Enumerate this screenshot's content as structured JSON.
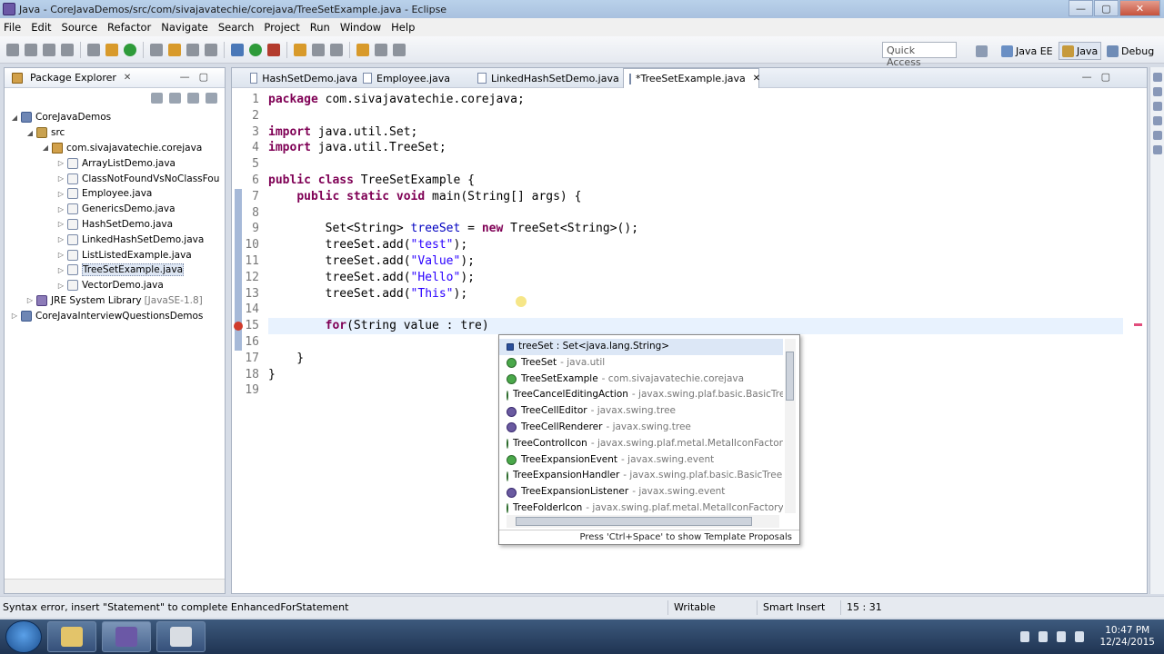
{
  "window": {
    "title": "Java - CoreJavaDemos/src/com/sivajavatechie/corejava/TreeSetExample.java - Eclipse",
    "min": "—",
    "max": "▢",
    "close": "✕"
  },
  "menu": [
    "File",
    "Edit",
    "Source",
    "Refactor",
    "Navigate",
    "Search",
    "Project",
    "Run",
    "Window",
    "Help"
  ],
  "toolbar": {
    "quick_access_placeholder": "Quick Access",
    "perspectives": [
      "Java EE",
      "Java",
      "Debug"
    ]
  },
  "package_explorer": {
    "title": "Package Explorer",
    "tree": [
      {
        "label": "CoreJavaDemos",
        "level": 0,
        "icon": "project-icon",
        "expanded": true
      },
      {
        "label": "src",
        "level": 1,
        "icon": "source-folder-icon",
        "expanded": true
      },
      {
        "label": "com.sivajavatechie.corejava",
        "level": 2,
        "icon": "package-icon",
        "expanded": true
      },
      {
        "label": "ArrayListDemo.java",
        "level": 3,
        "icon": "java-file-icon"
      },
      {
        "label": "ClassNotFoundVsNoClassFou",
        "level": 3,
        "icon": "java-file-icon"
      },
      {
        "label": "Employee.java",
        "level": 3,
        "icon": "java-file-icon"
      },
      {
        "label": "GenericsDemo.java",
        "level": 3,
        "icon": "java-file-icon"
      },
      {
        "label": "HashSetDemo.java",
        "level": 3,
        "icon": "java-file-icon"
      },
      {
        "label": "LinkedHashSetDemo.java",
        "level": 3,
        "icon": "java-file-icon"
      },
      {
        "label": "ListListedExample.java",
        "level": 3,
        "icon": "java-file-icon"
      },
      {
        "label": "TreeSetExample.java",
        "level": 3,
        "icon": "java-file-icon",
        "selected": true
      },
      {
        "label": "VectorDemo.java",
        "level": 3,
        "icon": "java-file-icon"
      },
      {
        "label": "JRE System Library",
        "suffix": "[JavaSE-1.8]",
        "level": 1,
        "icon": "library-icon"
      },
      {
        "label": "CoreJavaInterviewQuestionsDemos",
        "level": 0,
        "icon": "project-icon"
      }
    ]
  },
  "editor": {
    "tabs": [
      {
        "label": "HashSetDemo.java"
      },
      {
        "label": "Employee.java"
      },
      {
        "label": "LinkedHashSetDemo.java"
      },
      {
        "label": "*TreeSetExample.java",
        "active": true
      }
    ],
    "lines": [
      [
        {
          "t": "package",
          "c": "kw"
        },
        {
          "t": " com.sivajavatechie.corejava;"
        }
      ],
      [],
      [
        {
          "t": "import",
          "c": "kw"
        },
        {
          "t": " java.util.Set;"
        }
      ],
      [
        {
          "t": "import",
          "c": "kw"
        },
        {
          "t": " java.util.TreeSet;"
        }
      ],
      [],
      [
        {
          "t": "public",
          "c": "kw"
        },
        {
          "t": " "
        },
        {
          "t": "class",
          "c": "kw"
        },
        {
          "t": " TreeSetExample {"
        }
      ],
      [
        {
          "t": "    "
        },
        {
          "t": "public",
          "c": "kw"
        },
        {
          "t": " "
        },
        {
          "t": "static",
          "c": "kw"
        },
        {
          "t": " "
        },
        {
          "t": "void",
          "c": "kw"
        },
        {
          "t": " main(String[] args) {"
        }
      ],
      [],
      [
        {
          "t": "        Set<String> "
        },
        {
          "t": "treeSet",
          "c": "fld"
        },
        {
          "t": " = "
        },
        {
          "t": "new",
          "c": "kw"
        },
        {
          "t": " TreeSet<String>();"
        }
      ],
      [
        {
          "t": "        treeSet.add("
        },
        {
          "t": "\"test\"",
          "c": "str"
        },
        {
          "t": ");"
        }
      ],
      [
        {
          "t": "        treeSet.add("
        },
        {
          "t": "\"Value\"",
          "c": "str"
        },
        {
          "t": ");"
        }
      ],
      [
        {
          "t": "        treeSet.add("
        },
        {
          "t": "\"Hello\"",
          "c": "str"
        },
        {
          "t": ");"
        }
      ],
      [
        {
          "t": "        treeSet.add("
        },
        {
          "t": "\"This\"",
          "c": "str"
        },
        {
          "t": ");"
        }
      ],
      [],
      [
        {
          "t": "        "
        },
        {
          "t": "for",
          "c": "kw"
        },
        {
          "t": "(String value : tre)"
        }
      ],
      [],
      [
        {
          "t": "    }"
        }
      ],
      [
        {
          "t": "}"
        }
      ],
      []
    ],
    "current_line": 15,
    "error_line": 15
  },
  "content_assist": {
    "items": [
      {
        "name": "treeSet : Set<java.lang.String>",
        "qualifier": "",
        "kind": "field"
      },
      {
        "name": "TreeSet",
        "qualifier": "- java.util",
        "kind": "class"
      },
      {
        "name": "TreeSetExample",
        "qualifier": "- com.sivajavatechie.corejava",
        "kind": "class"
      },
      {
        "name": "TreeCancelEditingAction",
        "qualifier": "- javax.swing.plaf.basic.BasicTre",
        "kind": "class"
      },
      {
        "name": "TreeCellEditor",
        "qualifier": "- javax.swing.tree",
        "kind": "interface"
      },
      {
        "name": "TreeCellRenderer",
        "qualifier": "- javax.swing.tree",
        "kind": "interface"
      },
      {
        "name": "TreeControlIcon",
        "qualifier": "- javax.swing.plaf.metal.MetalIconFactor",
        "kind": "class"
      },
      {
        "name": "TreeExpansionEvent",
        "qualifier": "- javax.swing.event",
        "kind": "class"
      },
      {
        "name": "TreeExpansionHandler",
        "qualifier": "- javax.swing.plaf.basic.BasicTreeU",
        "kind": "class"
      },
      {
        "name": "TreeExpansionListener",
        "qualifier": "- javax.swing.event",
        "kind": "interface"
      },
      {
        "name": "TreeFolderIcon",
        "qualifier": "- javax.swing.plaf.metal.MetalIconFactory",
        "kind": "class"
      }
    ],
    "hint": "Press 'Ctrl+Space' to show Template Proposals"
  },
  "status": {
    "message": "Syntax error, insert \"Statement\" to complete EnhancedForStatement",
    "writable": "Writable",
    "insert_mode": "Smart Insert",
    "position": "15 : 31"
  },
  "taskbar": {
    "time": "10:47 PM",
    "date": "12/24/2015"
  },
  "colors": {
    "keyword": "#7f0055",
    "string": "#2a00ff",
    "field": "#0000c0",
    "current_line": "#e8f2fe"
  }
}
